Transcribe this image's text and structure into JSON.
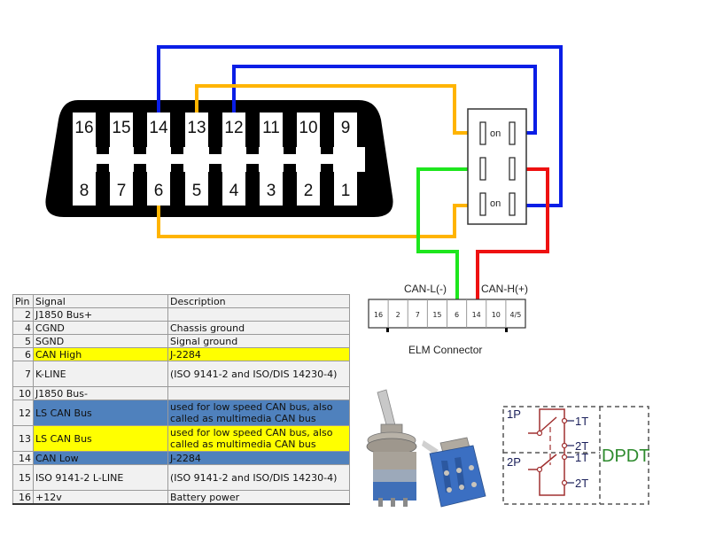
{
  "obd_connector": {
    "top_row_pins": [
      "16",
      "15",
      "14",
      "13",
      "12",
      "11",
      "10",
      "9"
    ],
    "bottom_row_pins": [
      "8",
      "7",
      "6",
      "5",
      "4",
      "3",
      "2",
      "1"
    ]
  },
  "switch": {
    "top_label": "on",
    "bottom_label": "on"
  },
  "wires": {
    "colors": {
      "pin14_blue": "#0a1ee6",
      "pin12_blue": "#0a1ee6",
      "pin13_orange": "#ffb400",
      "pin6_orange": "#ffb400",
      "can_low_green": "#1ee61e",
      "can_high_red": "#ee1111"
    }
  },
  "elm_connector": {
    "title": "ELM Connector",
    "can_low_label": "CAN-L(-)",
    "can_high_label": "CAN-H(+)",
    "pins": [
      "16",
      "2",
      "7",
      "15",
      "6",
      "14",
      "10",
      "4/5"
    ]
  },
  "pin_table": {
    "headers": [
      "Pin",
      "Signal",
      "Description"
    ],
    "rows": [
      {
        "pin": "2",
        "signal": "J1850 Bus+",
        "description": "",
        "highlight": "none"
      },
      {
        "pin": "4",
        "signal": "CGND",
        "description": "Chassis ground",
        "highlight": "none"
      },
      {
        "pin": "5",
        "signal": "SGND",
        "description": "Signal ground",
        "highlight": "none"
      },
      {
        "pin": "6",
        "signal": "CAN High",
        "description": "J-2284",
        "highlight": "yellow"
      },
      {
        "pin": "7",
        "signal": "K-LINE",
        "description": "(ISO 9141-2 and ISO/DIS 14230-4)",
        "highlight": "none"
      },
      {
        "pin": "10",
        "signal": "J1850 Bus-",
        "description": "",
        "highlight": "none"
      },
      {
        "pin": "12",
        "signal": "LS CAN Bus",
        "description": "used for low speed CAN bus, also called as multimedia CAN bus",
        "highlight": "blue"
      },
      {
        "pin": "13",
        "signal": "LS CAN Bus",
        "description": "used for low speed CAN bus, also called as multimedia CAN bus",
        "highlight": "yellow"
      },
      {
        "pin": "14",
        "signal": "CAN Low",
        "description": "J-2284",
        "highlight": "blue"
      },
      {
        "pin": "15",
        "signal": "ISO 9141-2 L-LINE",
        "description": "(ISO 9141-2 and ISO/DIS 14230-4)",
        "highlight": "none"
      },
      {
        "pin": "16",
        "signal": "+12v",
        "description": "Battery power",
        "highlight": "none"
      }
    ]
  },
  "dpdt_schematic": {
    "pole1": "1P",
    "pole2": "2P",
    "throw_labels": [
      "1T",
      "2T",
      "1T",
      "2T"
    ],
    "type_label": "DPDT"
  },
  "photo": {
    "subject": "mini toggle switch (DPDT), two views"
  }
}
